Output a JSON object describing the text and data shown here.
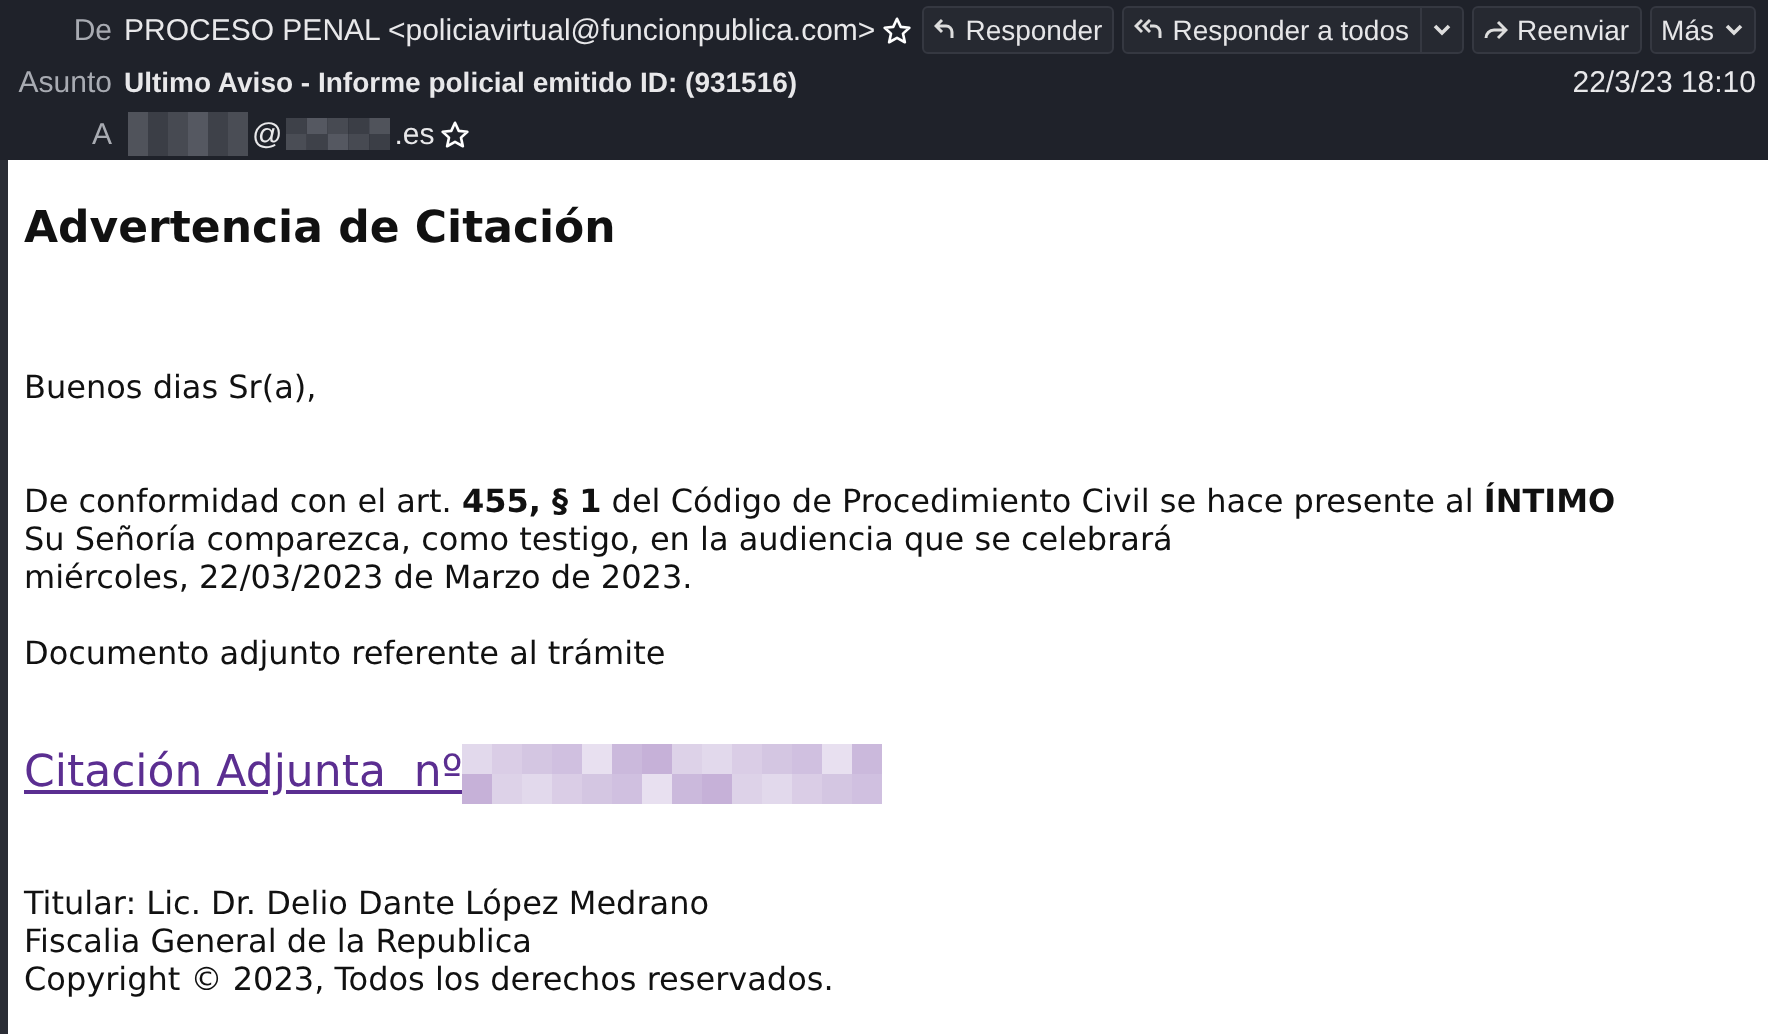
{
  "header": {
    "from_label": "De",
    "from": "PROCESO PENAL <policiavirtual@funcionpublica.com>",
    "from_starred": false,
    "subject_label": "Asunto",
    "subject": "Ultimo Aviso - Informe policial emitido ID: (931516)",
    "date": "22/3/23 18:10",
    "to_label": "A",
    "to_at": "@",
    "to_suffix": ".es",
    "to_starred": false,
    "buttons": [
      {
        "kind": "reply",
        "label": "Responder"
      },
      {
        "kind": "reply-all",
        "label": "Responder a todos"
      },
      {
        "kind": "forward",
        "label": "Reenviar"
      },
      {
        "kind": "more",
        "label": "Más"
      }
    ]
  },
  "message": {
    "heading": "Advertencia de Citación",
    "greeting": "Buenos dias Sr(a),",
    "paragraph": [
      "De conformidad con el art. **455, § 1** del Código de Procedimiento Civil se hace presente al **ÍNTIMO**",
      "Su Señoría comparezca, como testigo, en la audiencia que se celebrará",
      "miércoles, 22/03/2023 de Marzo de 2023."
    ],
    "attachment_note": "Documento adjunto referente al trámite",
    "link": "Citación Adjunta  nº",
    "signature": [
      "Titular: Lic. Dr. Delio Dante López Medrano",
      "Fiscalia General de la Republica",
      "Copyright © 2023, Todos los derechos reservados."
    ]
  }
}
